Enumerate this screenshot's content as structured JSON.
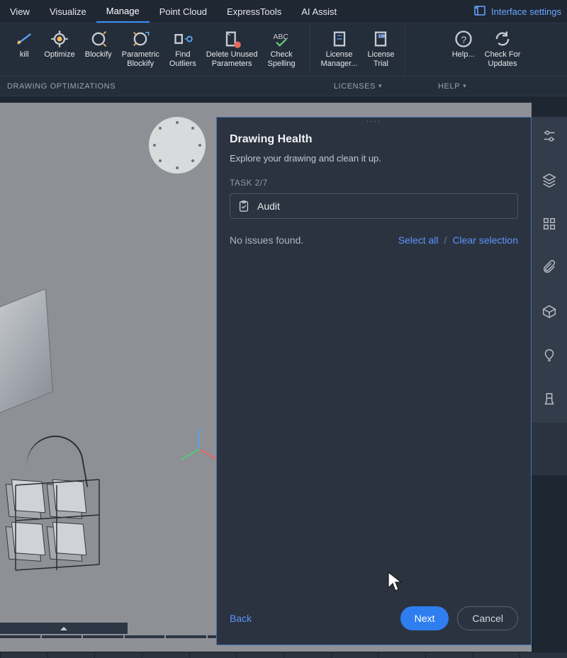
{
  "tabs": [
    "View",
    "Visualize",
    "Manage",
    "Point Cloud",
    "ExpressTools",
    "AI Assist"
  ],
  "activeTabIndex": 2,
  "interfaceSettings": "Interface settings",
  "ribbon": {
    "groups": [
      {
        "title": "DRAWING OPTIMIZATIONS",
        "items": [
          {
            "label": "kill"
          },
          {
            "label": "Optimize"
          },
          {
            "label": "Blockify"
          },
          {
            "label": "Parametric\nBlockify"
          },
          {
            "label": "Find\nOutliers"
          },
          {
            "label": "Delete Unused\nParameters"
          },
          {
            "label": "Check\nSpelling"
          }
        ]
      },
      {
        "title": "LICENSES",
        "items": [
          {
            "label": "License\nManager..."
          },
          {
            "label": "License\nTrial"
          }
        ]
      },
      {
        "title": "HELP",
        "items": [
          {
            "label": "Help..."
          },
          {
            "label": "Check For\nUpdates"
          }
        ]
      }
    ]
  },
  "panel": {
    "title": "Drawing Health",
    "subtitle": "Explore your drawing and clean it up.",
    "taskLabel": "TASK 2/7",
    "currentTask": "Audit",
    "status": "No issues found.",
    "selectAll": "Select all",
    "clearSelection": "Clear selection",
    "back": "Back",
    "next": "Next",
    "cancel": "Cancel"
  },
  "rail": [
    "settings-sliders-icon",
    "layers-icon",
    "grid-icon",
    "attachment-icon",
    "cube-edit-icon",
    "balloon-icon",
    "brush-icon",
    "cloud-upload-icon",
    "health-icon"
  ]
}
